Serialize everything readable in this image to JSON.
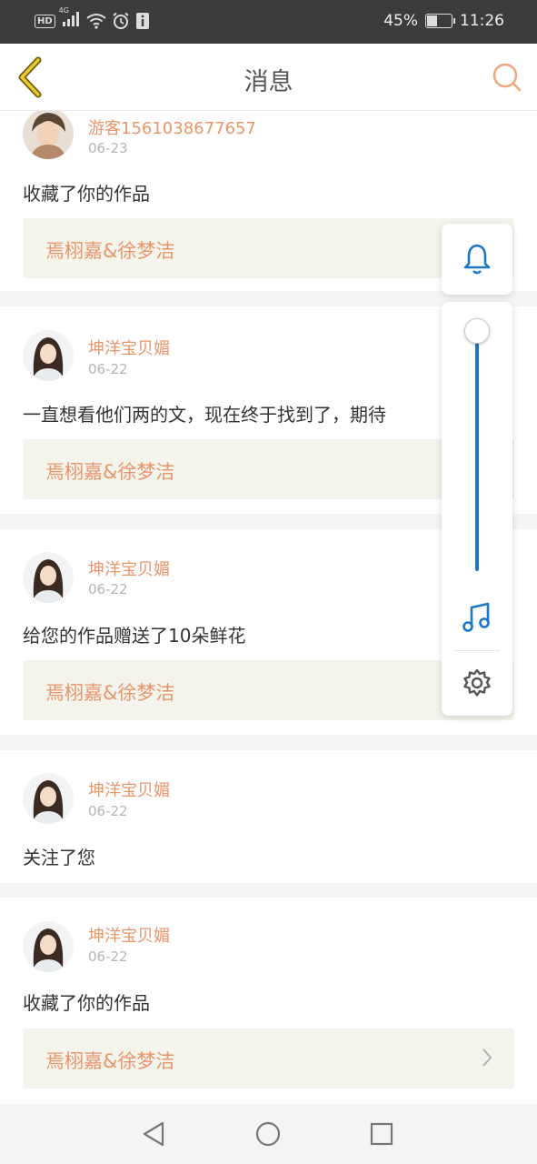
{
  "status_bar": {
    "hd_label": "HD",
    "network_label": "4G",
    "battery_percent": "45%",
    "battery_level": 0.45,
    "time": "11:26",
    "icons": [
      "hd-icon",
      "signal-icon",
      "wifi-icon",
      "alarm-icon",
      "notification-icon",
      "battery-icon"
    ]
  },
  "header": {
    "title": "消息",
    "back_icon": "chevron-left-icon",
    "search_icon": "search-icon"
  },
  "messages": [
    {
      "username": "游客1561038677657",
      "date": "06-23",
      "text": "收藏了你的作品",
      "work_title": "焉栩嘉&徐梦洁"
    },
    {
      "username": "坤洋宝贝媚",
      "date": "06-22",
      "text": "一直想看他们两的文，现在终于找到了，期待",
      "work_title": "焉栩嘉&徐梦洁"
    },
    {
      "username": "坤洋宝贝媚",
      "date": "06-22",
      "text": "给您的作品赠送了10朵鲜花",
      "work_title": "焉栩嘉&徐梦洁"
    },
    {
      "username": "坤洋宝贝媚",
      "date": "06-22",
      "text": "关注了您"
    },
    {
      "username": "坤洋宝贝媚",
      "date": "06-22",
      "text": "收藏了你的作品",
      "work_title": "焉栩嘉&徐梦洁"
    }
  ],
  "volume_panel": {
    "level": 1.0,
    "icons": [
      "bell-icon",
      "music-note-icon",
      "gear-icon"
    ],
    "accent": "#1a78c6"
  },
  "nav_bar": {
    "icons": [
      "back-triangle-icon",
      "home-circle-icon",
      "recents-square-icon"
    ]
  },
  "colors": {
    "accent": "#e8956a",
    "link_background": "#f4f3ec",
    "status_bar": "#3c3c3c"
  }
}
